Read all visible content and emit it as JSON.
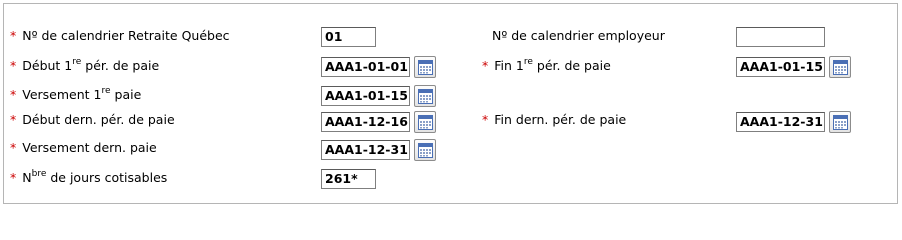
{
  "form": {
    "rows": [
      {
        "left": {
          "required": true,
          "label_pre": "Nº de calendrier Retraite Québec",
          "label_sup": "",
          "label_post": "",
          "value": "01",
          "has_calendar": false
        },
        "right": {
          "required": false,
          "label_pre": "Nº de calendrier employeur",
          "label_sup": "",
          "label_post": "",
          "value": "",
          "has_calendar": false
        }
      },
      {
        "left": {
          "required": true,
          "label_pre": "Début 1",
          "label_sup": "re",
          "label_post": " pér. de paie",
          "value": "AAA1-01-01",
          "has_calendar": true
        },
        "right": {
          "required": true,
          "label_pre": "Fin 1",
          "label_sup": "re",
          "label_post": " pér. de paie",
          "value": "AAA1-01-15",
          "has_calendar": true
        }
      },
      {
        "left": {
          "required": true,
          "label_pre": "Versement 1",
          "label_sup": "re",
          "label_post": " paie",
          "value": "AAA1-01-15",
          "has_calendar": true
        }
      },
      {
        "left": {
          "required": true,
          "label_pre": "Début dern. pér. de paie",
          "label_sup": "",
          "label_post": "",
          "value": "AAA1-12-16",
          "has_calendar": true
        },
        "right": {
          "required": true,
          "label_pre": "Fin dern. pér. de paie",
          "label_sup": "",
          "label_post": "",
          "value": "AAA1-12-31",
          "has_calendar": true
        }
      },
      {
        "left": {
          "required": true,
          "label_pre": "Versement dern. paie",
          "label_sup": "",
          "label_post": "",
          "value": "AAA1-12-31",
          "has_calendar": true
        }
      },
      {
        "left": {
          "required": true,
          "label_pre": "N",
          "label_sup": "bre",
          "label_post": " de jours cotisables",
          "value": "261*",
          "has_calendar": false
        }
      }
    ],
    "required_marker": "*",
    "calendar_icon": "calendar-icon",
    "colors": {
      "required": "#cc0000",
      "panel_border": "#b5b5b5",
      "calendar_header": "#4a6fb5"
    }
  }
}
